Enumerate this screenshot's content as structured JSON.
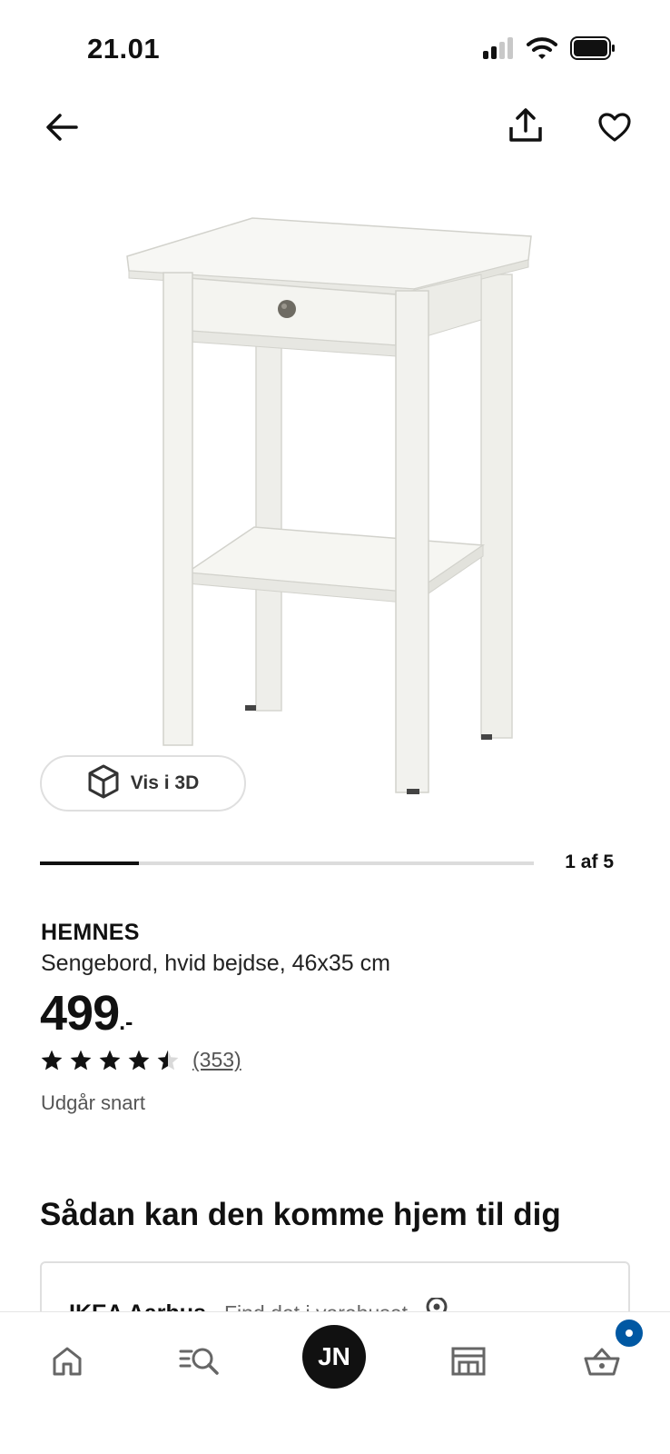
{
  "status_bar": {
    "time": "21.01",
    "icons": [
      "cellular-signal-icon",
      "wifi-icon",
      "battery-icon"
    ]
  },
  "top_nav": {
    "icons": [
      "arrow-left-icon",
      "share-icon",
      "heart-icon"
    ]
  },
  "gallery": {
    "view_3d_label": "Vis i 3D",
    "pager": "1 af 5",
    "current": 1,
    "total": 5
  },
  "product": {
    "brand": "HEMNES",
    "description": "Sengebord, hvid bejdse, 46x35 cm",
    "price": "499",
    "price_suffix": ".-",
    "rating": 4.5,
    "rating_max": 5,
    "review_count": "(353)",
    "availability": "Udgår snart"
  },
  "delivery": {
    "heading": "Sådan kan den komme hjem til dig",
    "store_name": "IKEA Aarhus",
    "store_link": "Find det i varehuset"
  },
  "bottom_nav": {
    "profile_initials": "JN",
    "items": [
      "home-icon",
      "search-icon",
      "profile-avatar",
      "store-icon",
      "cart-icon"
    ],
    "accent": "#0058a3"
  }
}
